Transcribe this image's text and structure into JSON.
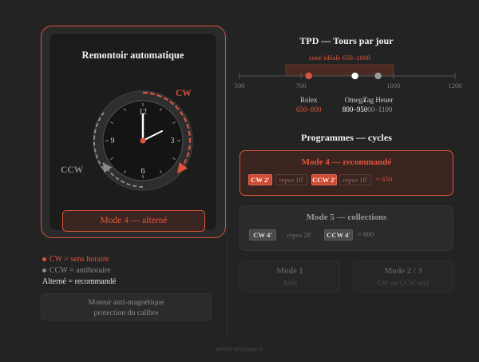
{
  "winder": {
    "title": "Remontoir automatique",
    "dial_numbers": [
      "12",
      "3",
      "6",
      "9"
    ],
    "cw_label": "CW",
    "ccw_label": "CCW",
    "mode_button": "Mode 4 — alterné"
  },
  "legend": {
    "cw": "CW = sens horaire",
    "ccw": "CCW = antihoraire",
    "alt": "Alterné = recommandé"
  },
  "motor": {
    "line1": "Moteur anti-magnétique",
    "line2": "protection du calibre"
  },
  "tpd": {
    "title": "TPD — Tours par jour",
    "zone_label": "zone idéale 650–1000",
    "zone_range": [
      650,
      1000
    ],
    "axis_ticks": [
      "500",
      "700",
      "1000",
      "1200"
    ],
    "axis_tick_values": [
      500,
      700,
      1000,
      1200
    ],
    "axis_range": [
      500,
      1200
    ],
    "brands": [
      {
        "name": "Rolex",
        "range": "650–800",
        "value": 725,
        "color": "#d9553c"
      },
      {
        "name": "Omega",
        "range": "800–950",
        "value": 875,
        "color": "#ffffff"
      },
      {
        "name": "Tag Heuer",
        "range": "800–1100",
        "value": 950,
        "color": "#9a9a9a"
      }
    ]
  },
  "programmes": {
    "title": "Programmes — cycles",
    "mode4": {
      "title": "Mode 4 — recommandé",
      "chips": [
        "CW 2'",
        "repos 18'",
        "CCW 2'",
        "repos 18'"
      ],
      "approx": "≈ 650"
    },
    "mode5": {
      "title": "Mode 5 — collections",
      "chips": [
        "CW 4'",
        "repos 28'",
        "CCW 4'"
      ],
      "approx": "≈ 800"
    },
    "mode1": {
      "title": "Mode 1",
      "sub": "Arrêt"
    },
    "mode23": {
      "title": "Mode 2 / 3",
      "sub": "CW ou CCW seul"
    }
  },
  "footer": "atelier-atypique.fr",
  "colors": {
    "accent": "#d9553c",
    "background": "#232323"
  }
}
